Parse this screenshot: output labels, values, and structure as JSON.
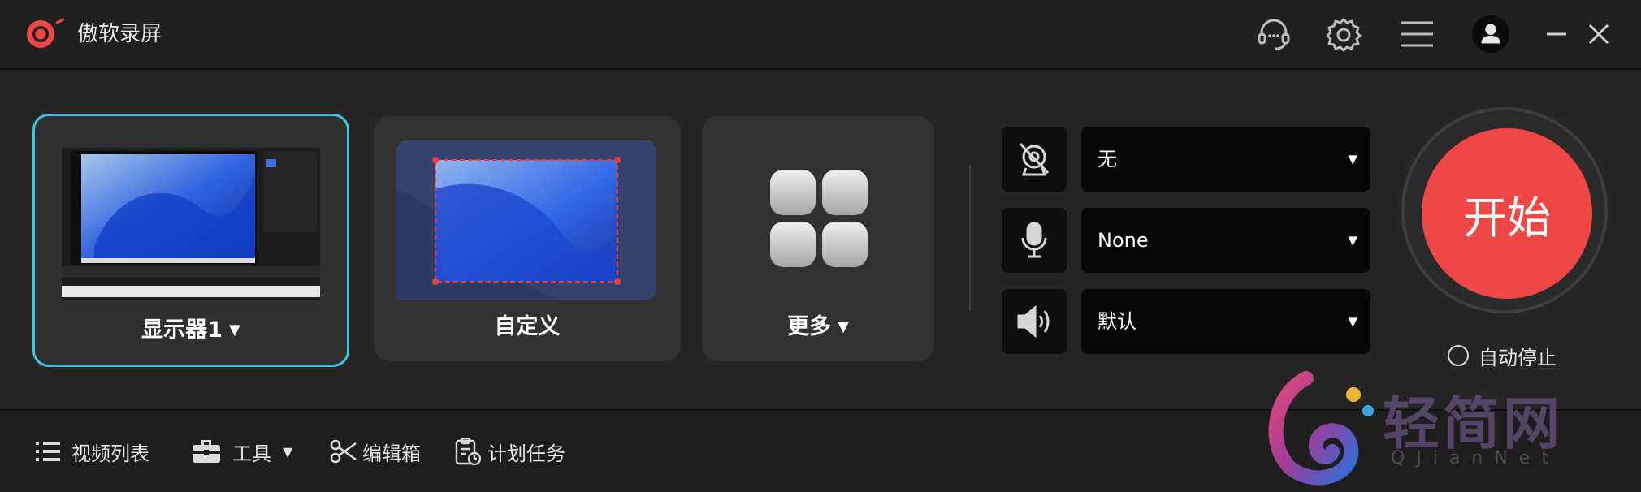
{
  "app": {
    "title": "傲软录屏"
  },
  "capture_modes": [
    {
      "label": "显示器1",
      "has_dropdown": true,
      "selected": true
    },
    {
      "label": "自定义",
      "has_dropdown": false,
      "selected": false
    },
    {
      "label": "更多",
      "has_dropdown": true,
      "selected": false
    }
  ],
  "devices": {
    "camera": {
      "icon": "camera-off-icon",
      "value": "无"
    },
    "microphone": {
      "icon": "microphone-icon",
      "value": "None"
    },
    "speaker": {
      "icon": "speaker-icon",
      "value": "默认"
    }
  },
  "start": {
    "label": "开始"
  },
  "auto_stop": {
    "label": "自动停止",
    "checked": false
  },
  "bottom_bar": {
    "video_list": "视频列表",
    "tools": "工具",
    "editor": "编辑箱",
    "schedule": "计划任务"
  },
  "watermark": {
    "text": "轻简网",
    "subtext": "QJianNet"
  },
  "colors": {
    "accent": "#3fc3e3",
    "start_red": "#ef4746",
    "background": "#252525"
  }
}
